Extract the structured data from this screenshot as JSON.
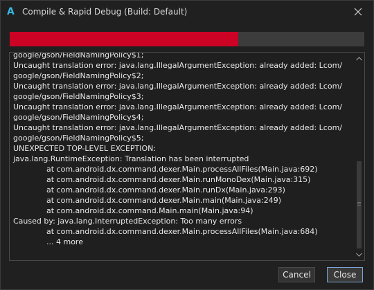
{
  "window": {
    "title": "Compile & Rapid Debug (Build: Default)",
    "app_icon": "A"
  },
  "progress": {
    "fraction": 0.645,
    "color": "#cc0325"
  },
  "log": {
    "lines": [
      {
        "text": "google/gson/FieldNamingPolicy$1;",
        "indent": false
      },
      {
        "text": "Uncaught translation error: java.lang.IllegalArgumentException: already added: Lcom/",
        "indent": false
      },
      {
        "text": "google/gson/FieldNamingPolicy$2;",
        "indent": false
      },
      {
        "text": "Uncaught translation error: java.lang.IllegalArgumentException: already added: Lcom/",
        "indent": false
      },
      {
        "text": "google/gson/FieldNamingPolicy$3;",
        "indent": false
      },
      {
        "text": "Uncaught translation error: java.lang.IllegalArgumentException: already added: Lcom/",
        "indent": false
      },
      {
        "text": "google/gson/FieldNamingPolicy$4;",
        "indent": false
      },
      {
        "text": "Uncaught translation error: java.lang.IllegalArgumentException: already added: Lcom/",
        "indent": false
      },
      {
        "text": "google/gson/FieldNamingPolicy$5;",
        "indent": false
      },
      {
        "text": "UNEXPECTED TOP-LEVEL EXCEPTION:",
        "indent": false
      },
      {
        "text": "java.lang.RuntimeException: Translation has been interrupted",
        "indent": false
      },
      {
        "text": "at com.android.dx.command.dexer.Main.processAllFiles(Main.java:692)",
        "indent": true
      },
      {
        "text": "at com.android.dx.command.dexer.Main.runMonoDex(Main.java:315)",
        "indent": true
      },
      {
        "text": "at com.android.dx.command.dexer.Main.runDx(Main.java:293)",
        "indent": true
      },
      {
        "text": "at com.android.dx.command.dexer.Main.main(Main.java:249)",
        "indent": true
      },
      {
        "text": "at com.android.dx.command.Main.main(Main.java:94)",
        "indent": true
      },
      {
        "text": "Caused by: java.lang.InterruptedException: Too many errors",
        "indent": false
      },
      {
        "text": "at com.android.dx.command.dexer.Main.processAllFiles(Main.java:684)",
        "indent": true
      },
      {
        "text": "... 4 more",
        "indent": true
      }
    ]
  },
  "buttons": {
    "cancel": "Cancel",
    "close": "Close"
  },
  "icons": {
    "close": "close-icon",
    "scroll_up": "chevron-up-icon",
    "scroll_down": "chevron-down-icon"
  }
}
